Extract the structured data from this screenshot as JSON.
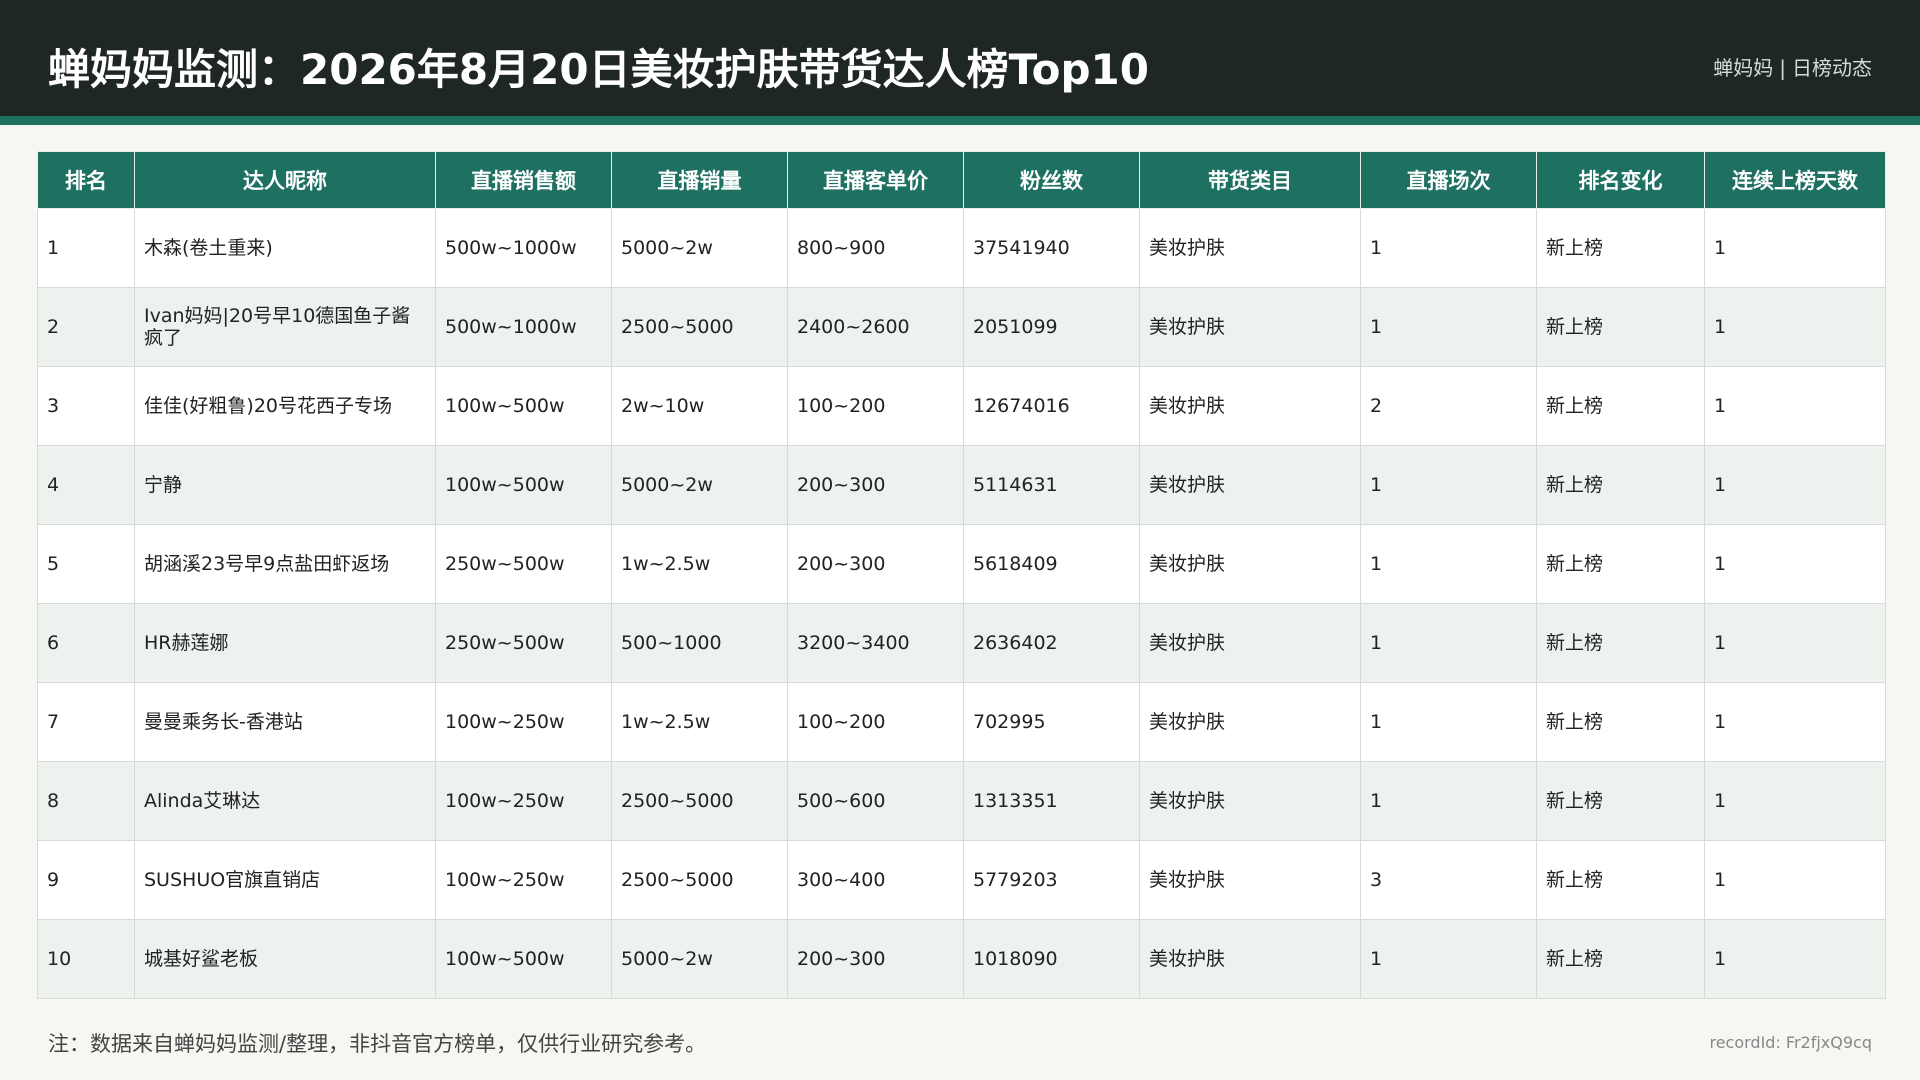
{
  "header": {
    "title": "蝉妈妈监测：2026年8月20日美妆护肤带货达人榜Top10",
    "brand": "蝉妈妈",
    "separator": "|",
    "section": "日榜动态"
  },
  "table": {
    "columns": [
      "排名",
      "达人昵称",
      "直播销售额",
      "直播销量",
      "直播客单价",
      "粉丝数",
      "带货类目",
      "直播场次",
      "排名变化",
      "连续上榜天数"
    ],
    "rows": [
      [
        "1",
        "木森(卷土重来)",
        "500w~1000w",
        "5000~2w",
        "800~900",
        "37541940",
        "美妆护肤",
        "1",
        "新上榜",
        "1"
      ],
      [
        "2",
        "Ivan妈妈|20号早10德国鱼子酱疯了",
        "500w~1000w",
        "2500~5000",
        "2400~2600",
        "2051099",
        "美妆护肤",
        "1",
        "新上榜",
        "1"
      ],
      [
        "3",
        "佳佳(好粗鲁)20号花西子专场",
        "100w~500w",
        "2w~10w",
        "100~200",
        "12674016",
        "美妆护肤",
        "2",
        "新上榜",
        "1"
      ],
      [
        "4",
        "宁静",
        "100w~500w",
        "5000~2w",
        "200~300",
        "5114631",
        "美妆护肤",
        "1",
        "新上榜",
        "1"
      ],
      [
        "5",
        "胡涵溪23号早9点盐田虾返场",
        "250w~500w",
        "1w~2.5w",
        "200~300",
        "5618409",
        "美妆护肤",
        "1",
        "新上榜",
        "1"
      ],
      [
        "6",
        "HR赫莲娜",
        "250w~500w",
        "500~1000",
        "3200~3400",
        "2636402",
        "美妆护肤",
        "1",
        "新上榜",
        "1"
      ],
      [
        "7",
        "曼曼乘务长-香港站",
        "100w~250w",
        "1w~2.5w",
        "100~200",
        "702995",
        "美妆护肤",
        "1",
        "新上榜",
        "1"
      ],
      [
        "8",
        "Alinda艾琳达",
        "100w~250w",
        "2500~5000",
        "500~600",
        "1313351",
        "美妆护肤",
        "1",
        "新上榜",
        "1"
      ],
      [
        "9",
        "SUSHUO官旗直销店",
        "100w~250w",
        "2500~5000",
        "300~400",
        "5779203",
        "美妆护肤",
        "3",
        "新上榜",
        "1"
      ],
      [
        "10",
        "城基好鲨老板",
        "100w~500w",
        "5000~2w",
        "200~300",
        "1018090",
        "美妆护肤",
        "1",
        "新上榜",
        "1"
      ]
    ]
  },
  "footer": {
    "note": "注：数据来自蝉妈妈监测/整理，非抖音官方榜单，仅供行业研究参考。",
    "record": "recordId: Fr2fjxQ9cq"
  },
  "colors": {
    "header_bg": "#1e2724",
    "accent": "#1e7060",
    "row_alt": "#edf2ef"
  }
}
